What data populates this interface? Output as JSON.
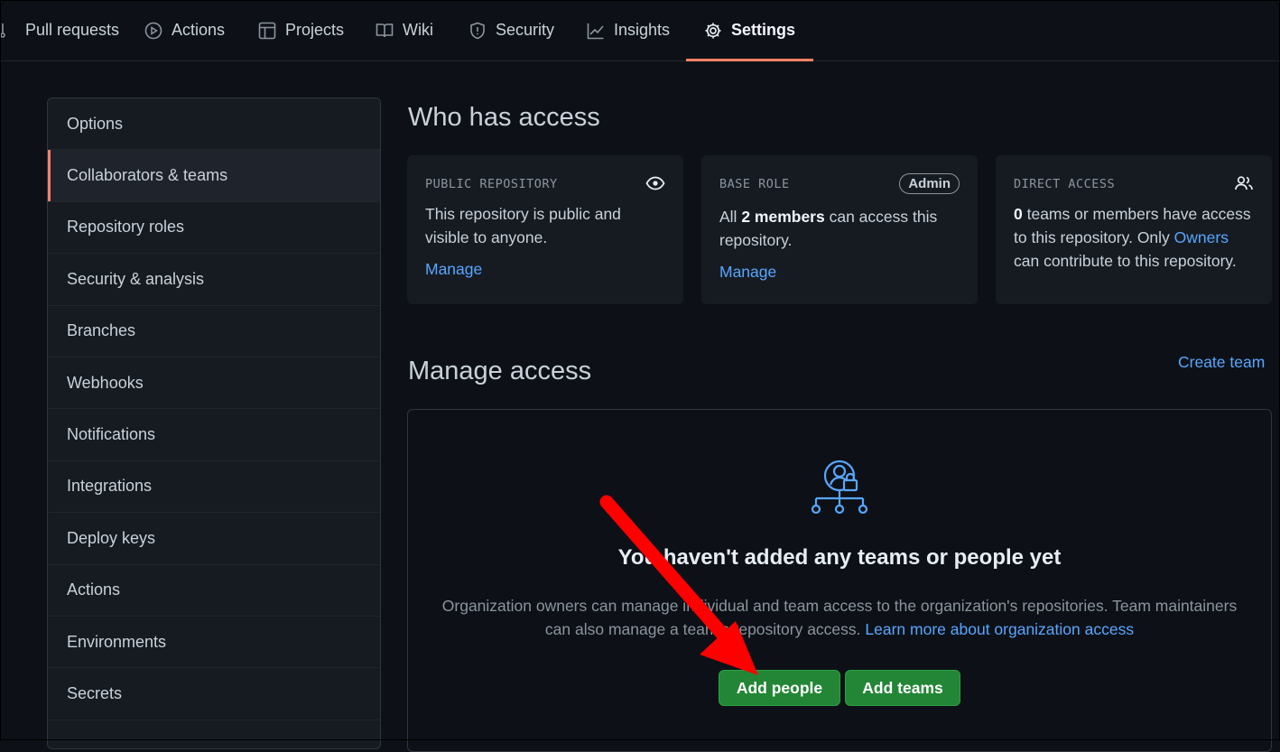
{
  "tabs": [
    {
      "label": "Pull requests",
      "icon": "pull-request-icon"
    },
    {
      "label": "Actions",
      "icon": "play-icon"
    },
    {
      "label": "Projects",
      "icon": "table-icon"
    },
    {
      "label": "Wiki",
      "icon": "book-icon"
    },
    {
      "label": "Security",
      "icon": "shield-icon"
    },
    {
      "label": "Insights",
      "icon": "graph-icon"
    },
    {
      "label": "Settings",
      "icon": "gear-icon",
      "active": true
    }
  ],
  "sidebar": {
    "items": [
      {
        "label": "Options"
      },
      {
        "label": "Collaborators & teams",
        "selected": true
      },
      {
        "label": "Repository roles"
      },
      {
        "label": "Security & analysis"
      },
      {
        "label": "Branches"
      },
      {
        "label": "Webhooks"
      },
      {
        "label": "Notifications"
      },
      {
        "label": "Integrations"
      },
      {
        "label": "Deploy keys"
      },
      {
        "label": "Actions"
      },
      {
        "label": "Environments"
      },
      {
        "label": "Secrets"
      }
    ]
  },
  "access": {
    "title": "Who has access",
    "public": {
      "label": "PUBLIC REPOSITORY",
      "text": "This repository is public and visible to anyone.",
      "manage": "Manage",
      "icon": "eye-icon"
    },
    "base_role": {
      "label": "BASE ROLE",
      "badge": "Admin",
      "text_pre": "All ",
      "text_bold": "2 members",
      "text_post": " can access this repository.",
      "manage": "Manage"
    },
    "direct": {
      "label": "DIRECT ACCESS",
      "icon": "people-icon",
      "text_bold": "0",
      "text_mid": " teams or members have access to this repository. Only ",
      "owners_link": "Owners",
      "text_post": " can contribute to this repository."
    }
  },
  "manage": {
    "title": "Manage access",
    "create_team": "Create team",
    "empty_icon": "org-access-icon",
    "empty_title": "You haven't added any teams or people yet",
    "empty_desc": "Organization owners can manage individual and team access to the organization's repositories. Team maintainers can also manage a team's repository access. ",
    "learn_more": "Learn more about organization access",
    "add_people": "Add people",
    "add_teams": "Add teams"
  },
  "colors": {
    "background": "#0d1117",
    "card": "#161b22",
    "accent": "#f78166",
    "link": "#58a6ff",
    "button": "#238636",
    "annotation_arrow": "#ff0000"
  }
}
